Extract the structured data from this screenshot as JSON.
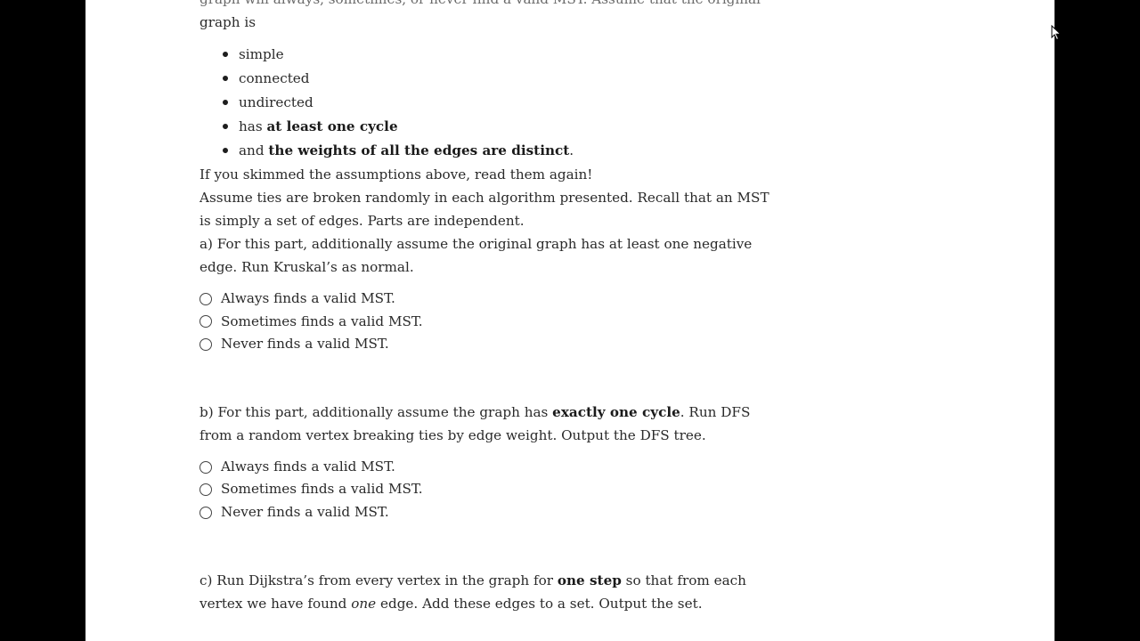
{
  "intro": {
    "line1_partial": "graph will always, sometimes, or never find a valid MST. Assume that the original",
    "line2": "graph is"
  },
  "assumptions": [
    {
      "pre": "",
      "bold": "",
      "text": "simple",
      "post": ""
    },
    {
      "pre": "",
      "bold": "",
      "text": "connected",
      "post": ""
    },
    {
      "pre": "",
      "bold": "",
      "text": "undirected",
      "post": ""
    },
    {
      "pre": "has ",
      "bold": "at least one cycle",
      "text": "",
      "post": ""
    },
    {
      "pre": "and ",
      "bold": "the weights of all the edges are distinct",
      "text": "",
      "post": "."
    }
  ],
  "reminder": "If you skimmed the assumptions above, read them again!",
  "ties_note": "Assume ties are broken randomly in each algorithm presented. Recall that an MST is simply a set of edges. Parts are independent.",
  "parts": [
    {
      "pre": "a) For this part, additionally assume the original graph has at least one negative edge. Run Kruskal’s as normal.",
      "bold": "",
      "post": "",
      "options": [
        "Always finds a valid MST.",
        "Sometimes finds a valid MST.",
        "Never finds a valid MST."
      ]
    },
    {
      "pre": "b) For this part, additionally assume the graph has ",
      "bold": "exactly one cycle",
      "post": ". Run DFS from a random vertex breaking ties by edge weight. Output the DFS tree.",
      "options": [
        "Always finds a valid MST.",
        "Sometimes finds a valid MST.",
        "Never finds a valid MST."
      ]
    },
    {
      "pre": "c) Run Dijkstra’s from every vertex in the graph for ",
      "bold": "one step",
      "mid": " so that from each vertex we have found ",
      "italic": "one",
      "post": " edge. Add these edges to a set. Output the set."
    }
  ],
  "colors": {
    "background": "#000000",
    "page": "#ffffff",
    "text": "#2a2a2a"
  },
  "icons": {
    "cursor": "mouse-pointer-icon"
  }
}
